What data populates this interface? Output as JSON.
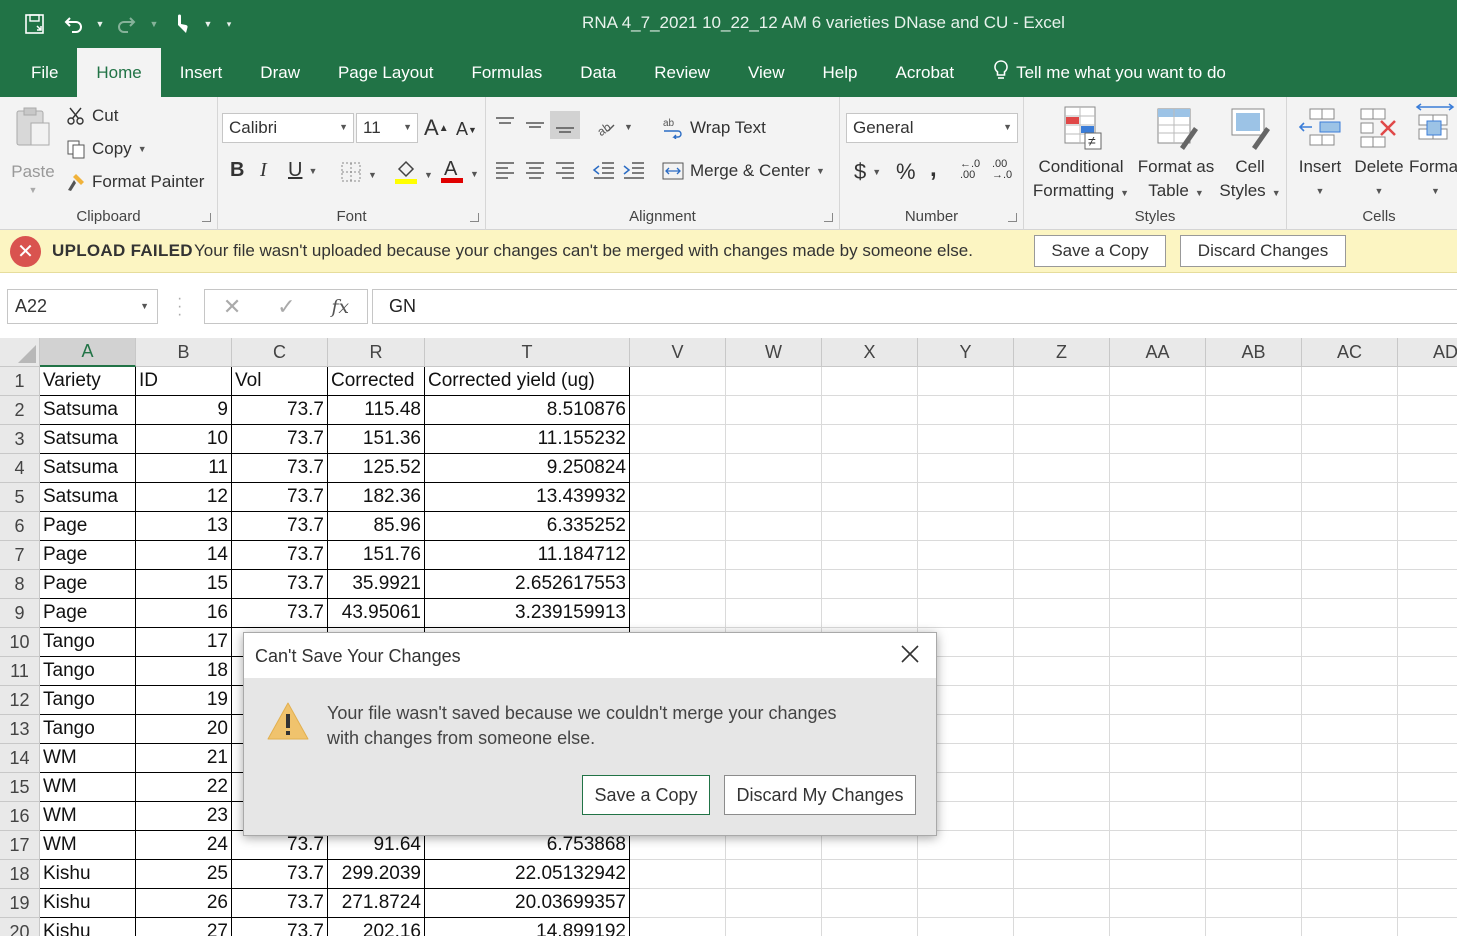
{
  "window": {
    "title": "RNA 4_7_2021 10_22_12 AM 6 varieties DNase and CU  -  Excel"
  },
  "tabs": [
    {
      "label": "File",
      "active": false
    },
    {
      "label": "Home",
      "active": true
    },
    {
      "label": "Insert",
      "active": false
    },
    {
      "label": "Draw",
      "active": false
    },
    {
      "label": "Page Layout",
      "active": false
    },
    {
      "label": "Formulas",
      "active": false
    },
    {
      "label": "Data",
      "active": false
    },
    {
      "label": "Review",
      "active": false
    },
    {
      "label": "View",
      "active": false
    },
    {
      "label": "Help",
      "active": false
    },
    {
      "label": "Acrobat",
      "active": false
    },
    {
      "label": "Tell me what you want to do",
      "active": false,
      "icon": "lightbulb-icon"
    }
  ],
  "ribbon": {
    "clipboard": {
      "label": "Clipboard",
      "paste": "Paste",
      "cut": "Cut",
      "copy": "Copy",
      "format_painter": "Format Painter"
    },
    "font": {
      "label": "Font",
      "font_name": "Calibri",
      "font_size": "11",
      "bold": "B",
      "italic": "I",
      "underline": "U"
    },
    "alignment": {
      "label": "Alignment",
      "wrap_text": "Wrap Text",
      "merge_center": "Merge & Center"
    },
    "number": {
      "label": "Number",
      "format": "General"
    },
    "styles": {
      "label": "Styles",
      "conditional": [
        "Conditional",
        "Formatting"
      ],
      "format_table": [
        "Format as",
        "Table"
      ],
      "cell_styles": [
        "Cell",
        "Styles"
      ]
    },
    "cells": {
      "label": "Cells",
      "insert": "Insert",
      "delete": "Delete",
      "format": "Format"
    }
  },
  "message_bar": {
    "title": "UPLOAD FAILED",
    "text": "Your file wasn't uploaded because your changes can't be merged with changes made by someone else.",
    "save_copy": "Save a Copy",
    "discard": "Discard Changes"
  },
  "formula_bar": {
    "name_box": "A22",
    "fx": "fx",
    "value": "GN"
  },
  "sheet": {
    "columns": [
      "A",
      "B",
      "C",
      "R",
      "T",
      "V",
      "W",
      "X",
      "Y",
      "Z",
      "AA",
      "AB",
      "AC",
      "AD"
    ],
    "selected_column": "A",
    "rows": [
      [
        "Variety",
        "ID",
        "Vol",
        "Corrected",
        "Corrected yield (ug)"
      ],
      [
        "Satsuma",
        "9",
        "73.7",
        "115.48",
        "8.510876"
      ],
      [
        "Satsuma",
        "10",
        "73.7",
        "151.36",
        "11.155232"
      ],
      [
        "Satsuma",
        "11",
        "73.7",
        "125.52",
        "9.250824"
      ],
      [
        "Satsuma",
        "12",
        "73.7",
        "182.36",
        "13.439932"
      ],
      [
        "Page",
        "13",
        "73.7",
        "85.96",
        "6.335252"
      ],
      [
        "Page",
        "14",
        "73.7",
        "151.76",
        "11.184712"
      ],
      [
        "Page",
        "15",
        "73.7",
        "35.9921",
        "2.652617553"
      ],
      [
        "Page",
        "16",
        "73.7",
        "43.95061",
        "3.239159913"
      ],
      [
        "Tango",
        "17",
        "",
        "",
        ""
      ],
      [
        "Tango",
        "18",
        "",
        "",
        ""
      ],
      [
        "Tango",
        "19",
        "",
        "",
        ""
      ],
      [
        "Tango",
        "20",
        "",
        "",
        ""
      ],
      [
        "WM",
        "21",
        "",
        "",
        ""
      ],
      [
        "WM",
        "22",
        "",
        "",
        ""
      ],
      [
        "WM",
        "23",
        "",
        "",
        ""
      ],
      [
        "WM",
        "24",
        "73.7",
        "91.64",
        "6.753868"
      ],
      [
        "Kishu",
        "25",
        "73.7",
        "299.2039",
        "22.05132942"
      ],
      [
        "Kishu",
        "26",
        "73.7",
        "271.8724",
        "20.03699357"
      ],
      [
        "Kishu",
        "27",
        "73.7",
        "202.16",
        "14.899192"
      ]
    ]
  },
  "dialog": {
    "title": "Can't Save Your Changes",
    "message": [
      "Your file wasn't saved because we couldn't merge your changes",
      "with changes from someone else."
    ],
    "save_copy": "Save a Copy",
    "discard": "Discard My Changes"
  },
  "colors": {
    "excel_green": "#217346",
    "message_bar_bg": "#fcf5c2",
    "error_red": "#d9534f",
    "warning_yellow": "#f0c36d"
  }
}
